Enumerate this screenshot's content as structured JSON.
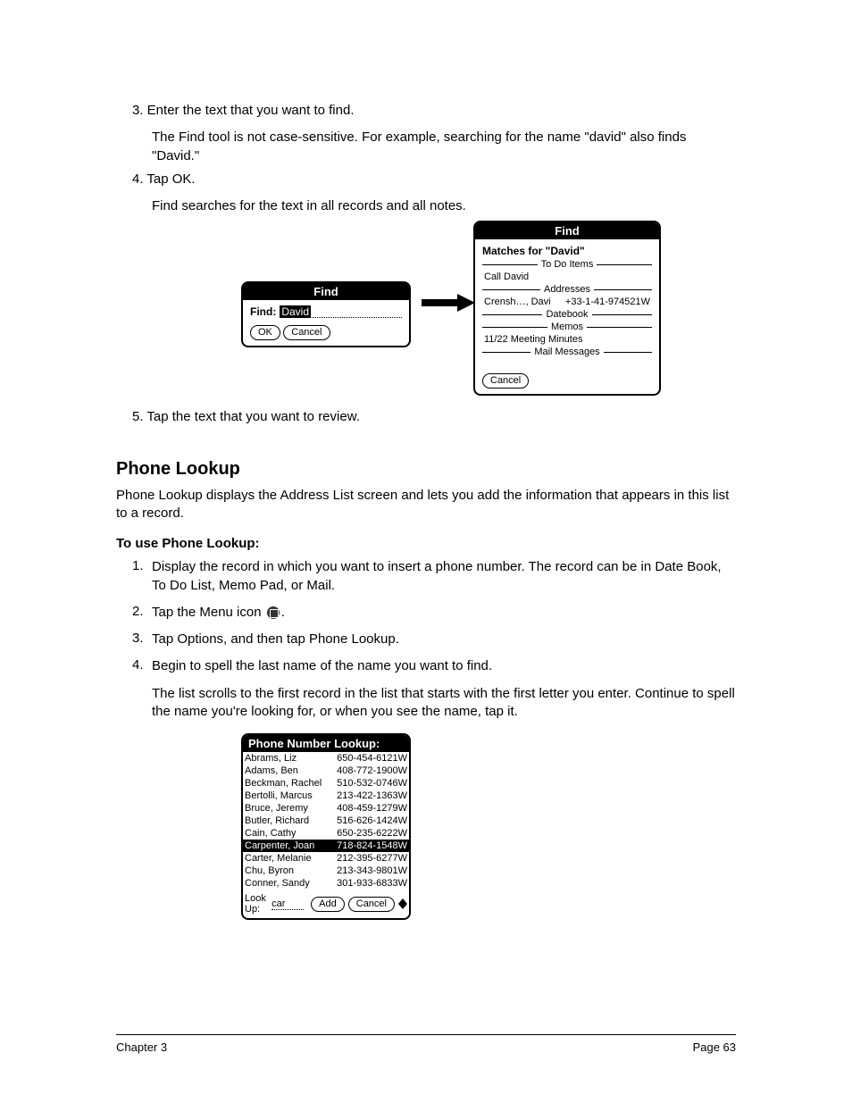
{
  "intro1": "3. Enter the text that you want to find.",
  "intro2": "The Find tool is not case-sensitive. For example, searching for the name \"david\" also finds \"David.\"",
  "intro3": "4. Tap OK.",
  "intro4": "Find searches for the text in all records and all notes.",
  "figure1": {
    "find_title": "Find",
    "find_label": "Find:",
    "find_value": "David",
    "ok": "OK",
    "cancel": "Cancel",
    "results_title": "Find",
    "matches_for": "Matches for \"David\"",
    "sec_todo": "To Do Items",
    "todo_item": "Call David",
    "sec_addr": "Addresses",
    "addr_name": "Crensh…, Davi",
    "addr_phone": "+33-1-41-974521W",
    "sec_datebook": "Datebook",
    "sec_memos": "Memos",
    "memo_item": "11/22 Meeting Minutes",
    "sec_mail": "Mail Messages"
  },
  "post1": "5. Tap the text that you want to review.",
  "section_title": "Phone Lookup",
  "section_body": "Phone Lookup displays the Address List screen and lets you add the information that appears in this list to a record.",
  "howto_title": "To use Phone Lookup:",
  "step1": "Display the record in which you want to insert a phone number. The record can be in Date Book, To Do List, Memo Pad, or Mail.",
  "step2a": "Tap the Menu icon ",
  "step2b": ".",
  "step3": "Tap Options, and then tap Phone Lookup.",
  "step4": "Begin to spell the last name of the name you want to find.",
  "step4b": "The list scrolls to the first record in the list that starts with the first letter you enter. Continue to spell the name you're looking for, or when you see the name, tap it.",
  "lookup": {
    "title": "Phone Number Lookup:",
    "rows": [
      {
        "name": "Abrams, Liz",
        "phone": "650-454-6121W"
      },
      {
        "name": "Adams, Ben",
        "phone": "408-772-1900W"
      },
      {
        "name": "Beckman, Rachel",
        "phone": "510-532-0746W"
      },
      {
        "name": "Bertolli, Marcus",
        "phone": "213-422-1363W"
      },
      {
        "name": "Bruce, Jeremy",
        "phone": "408-459-1279W"
      },
      {
        "name": "Butler, Richard",
        "phone": "516-626-1424W"
      },
      {
        "name": "Cain, Cathy",
        "phone": "650-235-6222W"
      },
      {
        "name": "Carpenter, Joan",
        "phone": "718-824-1548W",
        "selected": true
      },
      {
        "name": "Carter, Melanie",
        "phone": "212-395-6277W"
      },
      {
        "name": "Chu, Byron",
        "phone": "213-343-9801W"
      },
      {
        "name": "Conner, Sandy",
        "phone": "301-933-6833W"
      }
    ],
    "lookup_label": "Look Up:",
    "lookup_value": "car",
    "add": "Add",
    "cancel": "Cancel"
  },
  "footer_left": "Chapter 3",
  "footer_right": "Page 63"
}
